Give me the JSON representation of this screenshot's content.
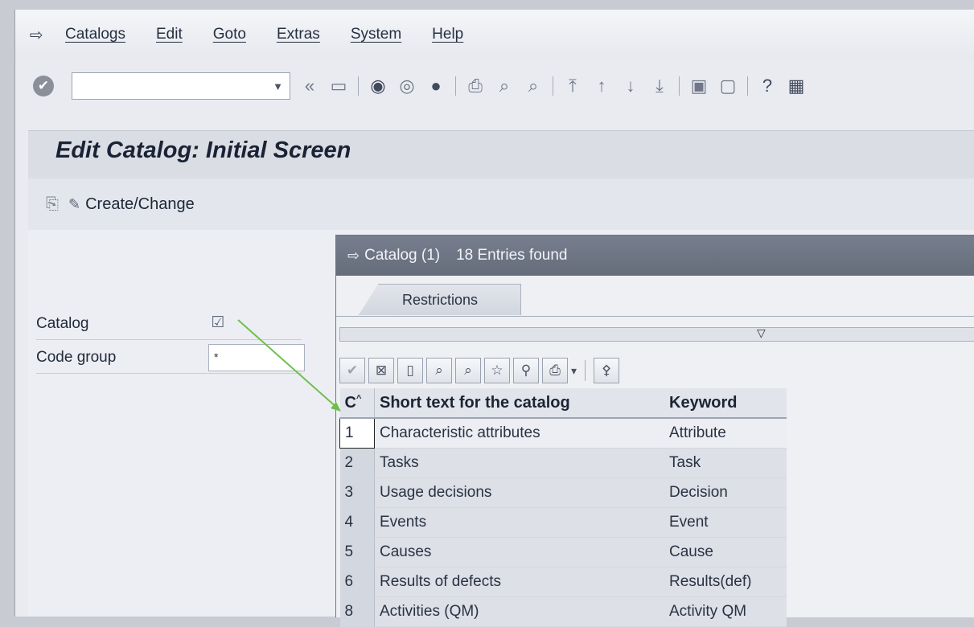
{
  "menubar": {
    "items": [
      "Catalogs",
      "Edit",
      "Goto",
      "Extras",
      "System",
      "Help"
    ]
  },
  "toolbar": {
    "command_field_value": ""
  },
  "title": "Edit Catalog: Initial Screen",
  "app_toolbar": {
    "create_change_label": "Create/Change"
  },
  "selection": {
    "catalog_label": "Catalog",
    "code_group_label": "Code group",
    "code_group_value": "*"
  },
  "popup": {
    "title": "Catalog (1)",
    "entries_found": "18 Entries found",
    "tab_label": "Restrictions",
    "columns": {
      "code": "C",
      "short_text": "Short text for the catalog",
      "keyword": "Keyword"
    },
    "rows": [
      {
        "code": "1",
        "short_text": "Characteristic attributes",
        "keyword": "Attribute"
      },
      {
        "code": "2",
        "short_text": "Tasks",
        "keyword": "Task"
      },
      {
        "code": "3",
        "short_text": "Usage decisions",
        "keyword": "Decision"
      },
      {
        "code": "4",
        "short_text": "Events",
        "keyword": "Event"
      },
      {
        "code": "5",
        "short_text": "Causes",
        "keyword": "Cause"
      },
      {
        "code": "6",
        "short_text": "Results of defects",
        "keyword": "Results(def)"
      },
      {
        "code": "8",
        "short_text": "Activities (QM)",
        "keyword": "Activity QM"
      }
    ]
  },
  "colors": {
    "popup_header": "#6e7584",
    "title_bar": "#dadde4",
    "arrow": "#6fbf4a"
  }
}
